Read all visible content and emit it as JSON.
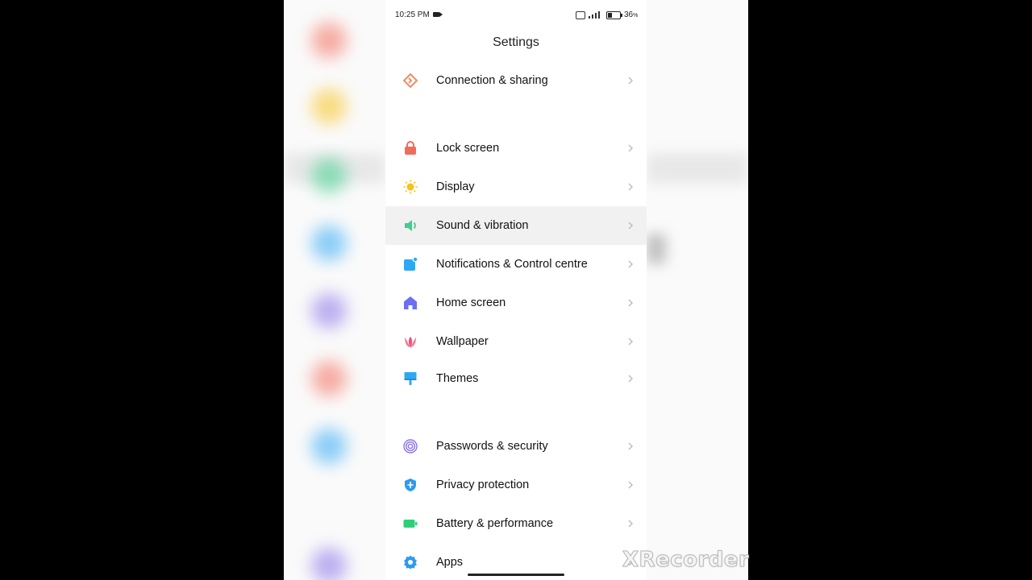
{
  "status_bar": {
    "time": "10:25 PM",
    "battery_percent": "36",
    "battery_level": 0.36
  },
  "header": {
    "title": "Settings"
  },
  "settings_items": [
    {
      "label": "Connection & sharing",
      "icon": "connection-sharing-icon",
      "color": "#f08a62"
    },
    {
      "label": "Lock screen",
      "icon": "lock-icon",
      "color": "#f36b5a"
    },
    {
      "label": "Display",
      "icon": "sun-icon",
      "color": "#f7c21a"
    },
    {
      "label": "Sound & vibration",
      "icon": "speaker-icon",
      "color": "#3ecf8e",
      "selected": true
    },
    {
      "label": "Notifications & Control centre",
      "icon": "notification-icon",
      "color": "#2ea8f5"
    },
    {
      "label": "Home screen",
      "icon": "home-icon",
      "color": "#6b6ff0"
    },
    {
      "label": "Wallpaper",
      "icon": "wallpaper-flower-icon",
      "color": "#f0567e"
    },
    {
      "label": "Themes",
      "icon": "themes-brush-icon",
      "color": "#2ea8f5"
    },
    {
      "label": "Passwords & security",
      "icon": "fingerprint-icon",
      "color": "#8a72e8"
    },
    {
      "label": "Privacy protection",
      "icon": "privacy-shield-icon",
      "color": "#2b9bf0"
    },
    {
      "label": "Battery & performance",
      "icon": "battery-icon",
      "color": "#2fcf7a"
    },
    {
      "label": "Apps",
      "icon": "gear-icon",
      "color": "#2b9bf0"
    }
  ],
  "watermark": "XRecorder"
}
